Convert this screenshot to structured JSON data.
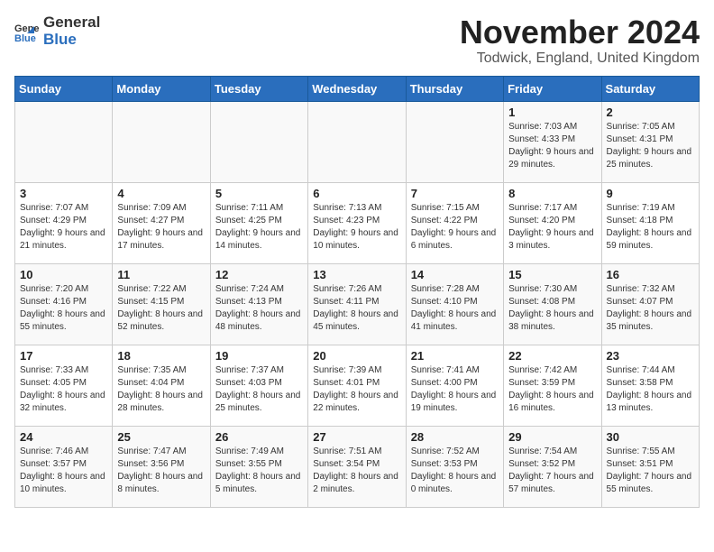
{
  "header": {
    "logo_general": "General",
    "logo_blue": "Blue",
    "month_title": "November 2024",
    "location": "Todwick, England, United Kingdom"
  },
  "days_of_week": [
    "Sunday",
    "Monday",
    "Tuesday",
    "Wednesday",
    "Thursday",
    "Friday",
    "Saturday"
  ],
  "weeks": [
    [
      {
        "day": "",
        "info": ""
      },
      {
        "day": "",
        "info": ""
      },
      {
        "day": "",
        "info": ""
      },
      {
        "day": "",
        "info": ""
      },
      {
        "day": "",
        "info": ""
      },
      {
        "day": "1",
        "info": "Sunrise: 7:03 AM\nSunset: 4:33 PM\nDaylight: 9 hours and 29 minutes."
      },
      {
        "day": "2",
        "info": "Sunrise: 7:05 AM\nSunset: 4:31 PM\nDaylight: 9 hours and 25 minutes."
      }
    ],
    [
      {
        "day": "3",
        "info": "Sunrise: 7:07 AM\nSunset: 4:29 PM\nDaylight: 9 hours and 21 minutes."
      },
      {
        "day": "4",
        "info": "Sunrise: 7:09 AM\nSunset: 4:27 PM\nDaylight: 9 hours and 17 minutes."
      },
      {
        "day": "5",
        "info": "Sunrise: 7:11 AM\nSunset: 4:25 PM\nDaylight: 9 hours and 14 minutes."
      },
      {
        "day": "6",
        "info": "Sunrise: 7:13 AM\nSunset: 4:23 PM\nDaylight: 9 hours and 10 minutes."
      },
      {
        "day": "7",
        "info": "Sunrise: 7:15 AM\nSunset: 4:22 PM\nDaylight: 9 hours and 6 minutes."
      },
      {
        "day": "8",
        "info": "Sunrise: 7:17 AM\nSunset: 4:20 PM\nDaylight: 9 hours and 3 minutes."
      },
      {
        "day": "9",
        "info": "Sunrise: 7:19 AM\nSunset: 4:18 PM\nDaylight: 8 hours and 59 minutes."
      }
    ],
    [
      {
        "day": "10",
        "info": "Sunrise: 7:20 AM\nSunset: 4:16 PM\nDaylight: 8 hours and 55 minutes."
      },
      {
        "day": "11",
        "info": "Sunrise: 7:22 AM\nSunset: 4:15 PM\nDaylight: 8 hours and 52 minutes."
      },
      {
        "day": "12",
        "info": "Sunrise: 7:24 AM\nSunset: 4:13 PM\nDaylight: 8 hours and 48 minutes."
      },
      {
        "day": "13",
        "info": "Sunrise: 7:26 AM\nSunset: 4:11 PM\nDaylight: 8 hours and 45 minutes."
      },
      {
        "day": "14",
        "info": "Sunrise: 7:28 AM\nSunset: 4:10 PM\nDaylight: 8 hours and 41 minutes."
      },
      {
        "day": "15",
        "info": "Sunrise: 7:30 AM\nSunset: 4:08 PM\nDaylight: 8 hours and 38 minutes."
      },
      {
        "day": "16",
        "info": "Sunrise: 7:32 AM\nSunset: 4:07 PM\nDaylight: 8 hours and 35 minutes."
      }
    ],
    [
      {
        "day": "17",
        "info": "Sunrise: 7:33 AM\nSunset: 4:05 PM\nDaylight: 8 hours and 32 minutes."
      },
      {
        "day": "18",
        "info": "Sunrise: 7:35 AM\nSunset: 4:04 PM\nDaylight: 8 hours and 28 minutes."
      },
      {
        "day": "19",
        "info": "Sunrise: 7:37 AM\nSunset: 4:03 PM\nDaylight: 8 hours and 25 minutes."
      },
      {
        "day": "20",
        "info": "Sunrise: 7:39 AM\nSunset: 4:01 PM\nDaylight: 8 hours and 22 minutes."
      },
      {
        "day": "21",
        "info": "Sunrise: 7:41 AM\nSunset: 4:00 PM\nDaylight: 8 hours and 19 minutes."
      },
      {
        "day": "22",
        "info": "Sunrise: 7:42 AM\nSunset: 3:59 PM\nDaylight: 8 hours and 16 minutes."
      },
      {
        "day": "23",
        "info": "Sunrise: 7:44 AM\nSunset: 3:58 PM\nDaylight: 8 hours and 13 minutes."
      }
    ],
    [
      {
        "day": "24",
        "info": "Sunrise: 7:46 AM\nSunset: 3:57 PM\nDaylight: 8 hours and 10 minutes."
      },
      {
        "day": "25",
        "info": "Sunrise: 7:47 AM\nSunset: 3:56 PM\nDaylight: 8 hours and 8 minutes."
      },
      {
        "day": "26",
        "info": "Sunrise: 7:49 AM\nSunset: 3:55 PM\nDaylight: 8 hours and 5 minutes."
      },
      {
        "day": "27",
        "info": "Sunrise: 7:51 AM\nSunset: 3:54 PM\nDaylight: 8 hours and 2 minutes."
      },
      {
        "day": "28",
        "info": "Sunrise: 7:52 AM\nSunset: 3:53 PM\nDaylight: 8 hours and 0 minutes."
      },
      {
        "day": "29",
        "info": "Sunrise: 7:54 AM\nSunset: 3:52 PM\nDaylight: 7 hours and 57 minutes."
      },
      {
        "day": "30",
        "info": "Sunrise: 7:55 AM\nSunset: 3:51 PM\nDaylight: 7 hours and 55 minutes."
      }
    ]
  ]
}
